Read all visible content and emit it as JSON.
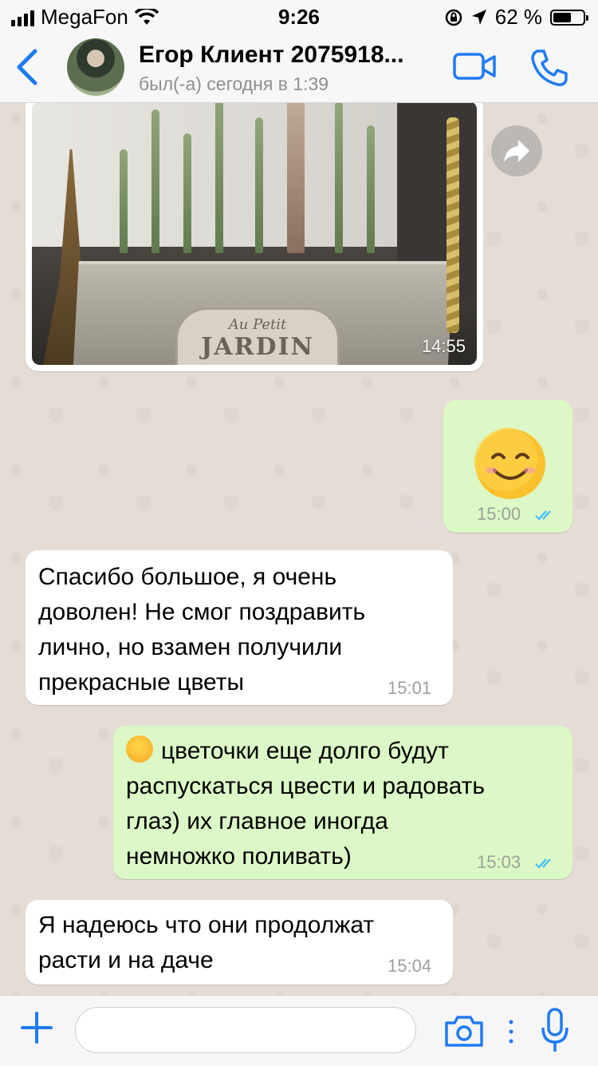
{
  "status_bar": {
    "carrier": "MegaFon",
    "time": "9:26",
    "battery": "62 %",
    "battery_level": 0.62
  },
  "header": {
    "contact_name": "Егор Клиент 2075918...",
    "contact_status": "был(-а) сегодня в 1:39"
  },
  "messages": [
    {
      "type": "photo",
      "direction": "incoming",
      "time": "14:55",
      "photo_text_small": "Au Petit",
      "photo_text_large": "JARDIN"
    },
    {
      "type": "emoji",
      "direction": "outgoing",
      "time": "15:00",
      "read": true
    },
    {
      "type": "text",
      "direction": "incoming",
      "lines": [
        "Спасибо большое, я очень",
        "доволен! Не смог поздравить",
        "лично, но взамен получили",
        "прекрасные цветы"
      ],
      "time": "15:01"
    },
    {
      "type": "text",
      "direction": "outgoing",
      "lines": [
        "цветочки еще долго будут",
        "распускаться цвести и радовать",
        "глаз) их главное иногда",
        "немножко поливать)"
      ],
      "time": "15:03",
      "read": true
    },
    {
      "type": "text",
      "direction": "incoming",
      "lines": [
        "Я надеюсь что они продолжат",
        "расти и на даче"
      ],
      "time": "15:04"
    }
  ],
  "input": {
    "placeholder": ""
  },
  "colors": {
    "accent": "#1f7bf2",
    "outgoing_bubble": "#dcf8c6",
    "incoming_bubble": "#ffffff",
    "read_ticks": "#4fc3f7"
  },
  "icons": [
    "signal-icon",
    "wifi-icon",
    "lock-rotation-icon",
    "location-icon",
    "battery-icon",
    "back-chevron-icon",
    "video-call-icon",
    "phone-icon",
    "forward-icon",
    "read-ticks-icon",
    "plus-icon",
    "sticker-icon",
    "camera-icon",
    "microphone-icon"
  ]
}
